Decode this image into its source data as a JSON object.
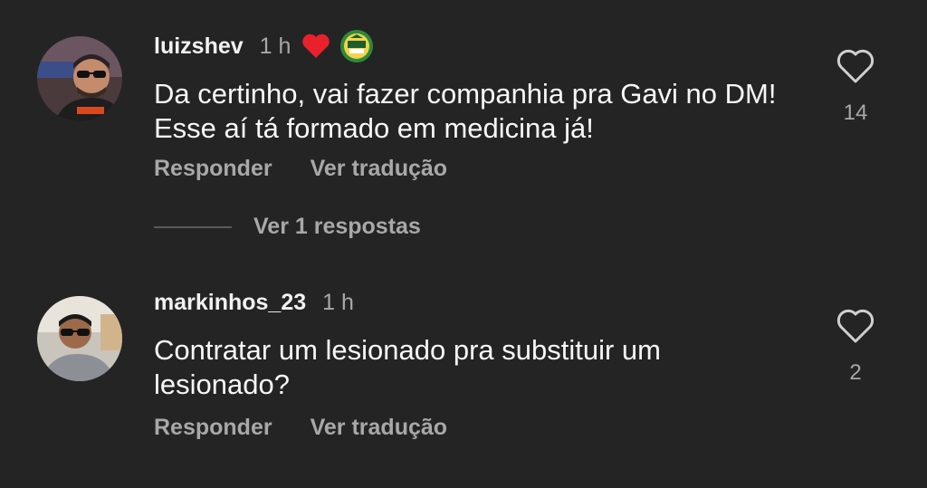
{
  "comments": [
    {
      "username": "luizshev",
      "time": "1 h",
      "text_line1": "Da certinho,  vai fazer companhia pra Gavi no DM!",
      "text_line2": "Esse aí tá formado em medicina já!",
      "reply_label": "Responder",
      "translate_label": "Ver tradução",
      "like_count": "14"
    },
    {
      "username": "markinhos_23",
      "time": "1 h",
      "text_line1": "Contratar um lesionado pra substituir um",
      "text_line2": "lesionado?",
      "reply_label": "Responder",
      "translate_label": "Ver tradução",
      "like_count": "2"
    }
  ],
  "view_replies_label": "Ver 1 respostas",
  "colors": {
    "background": "#242424",
    "heart_badge": "#e8212c",
    "secondary_text": "#a8a8a8"
  },
  "icons": {
    "badge_heart": "heart-filled-icon",
    "badge_club": "club-crest-icon",
    "like": "heart-outline-icon"
  }
}
